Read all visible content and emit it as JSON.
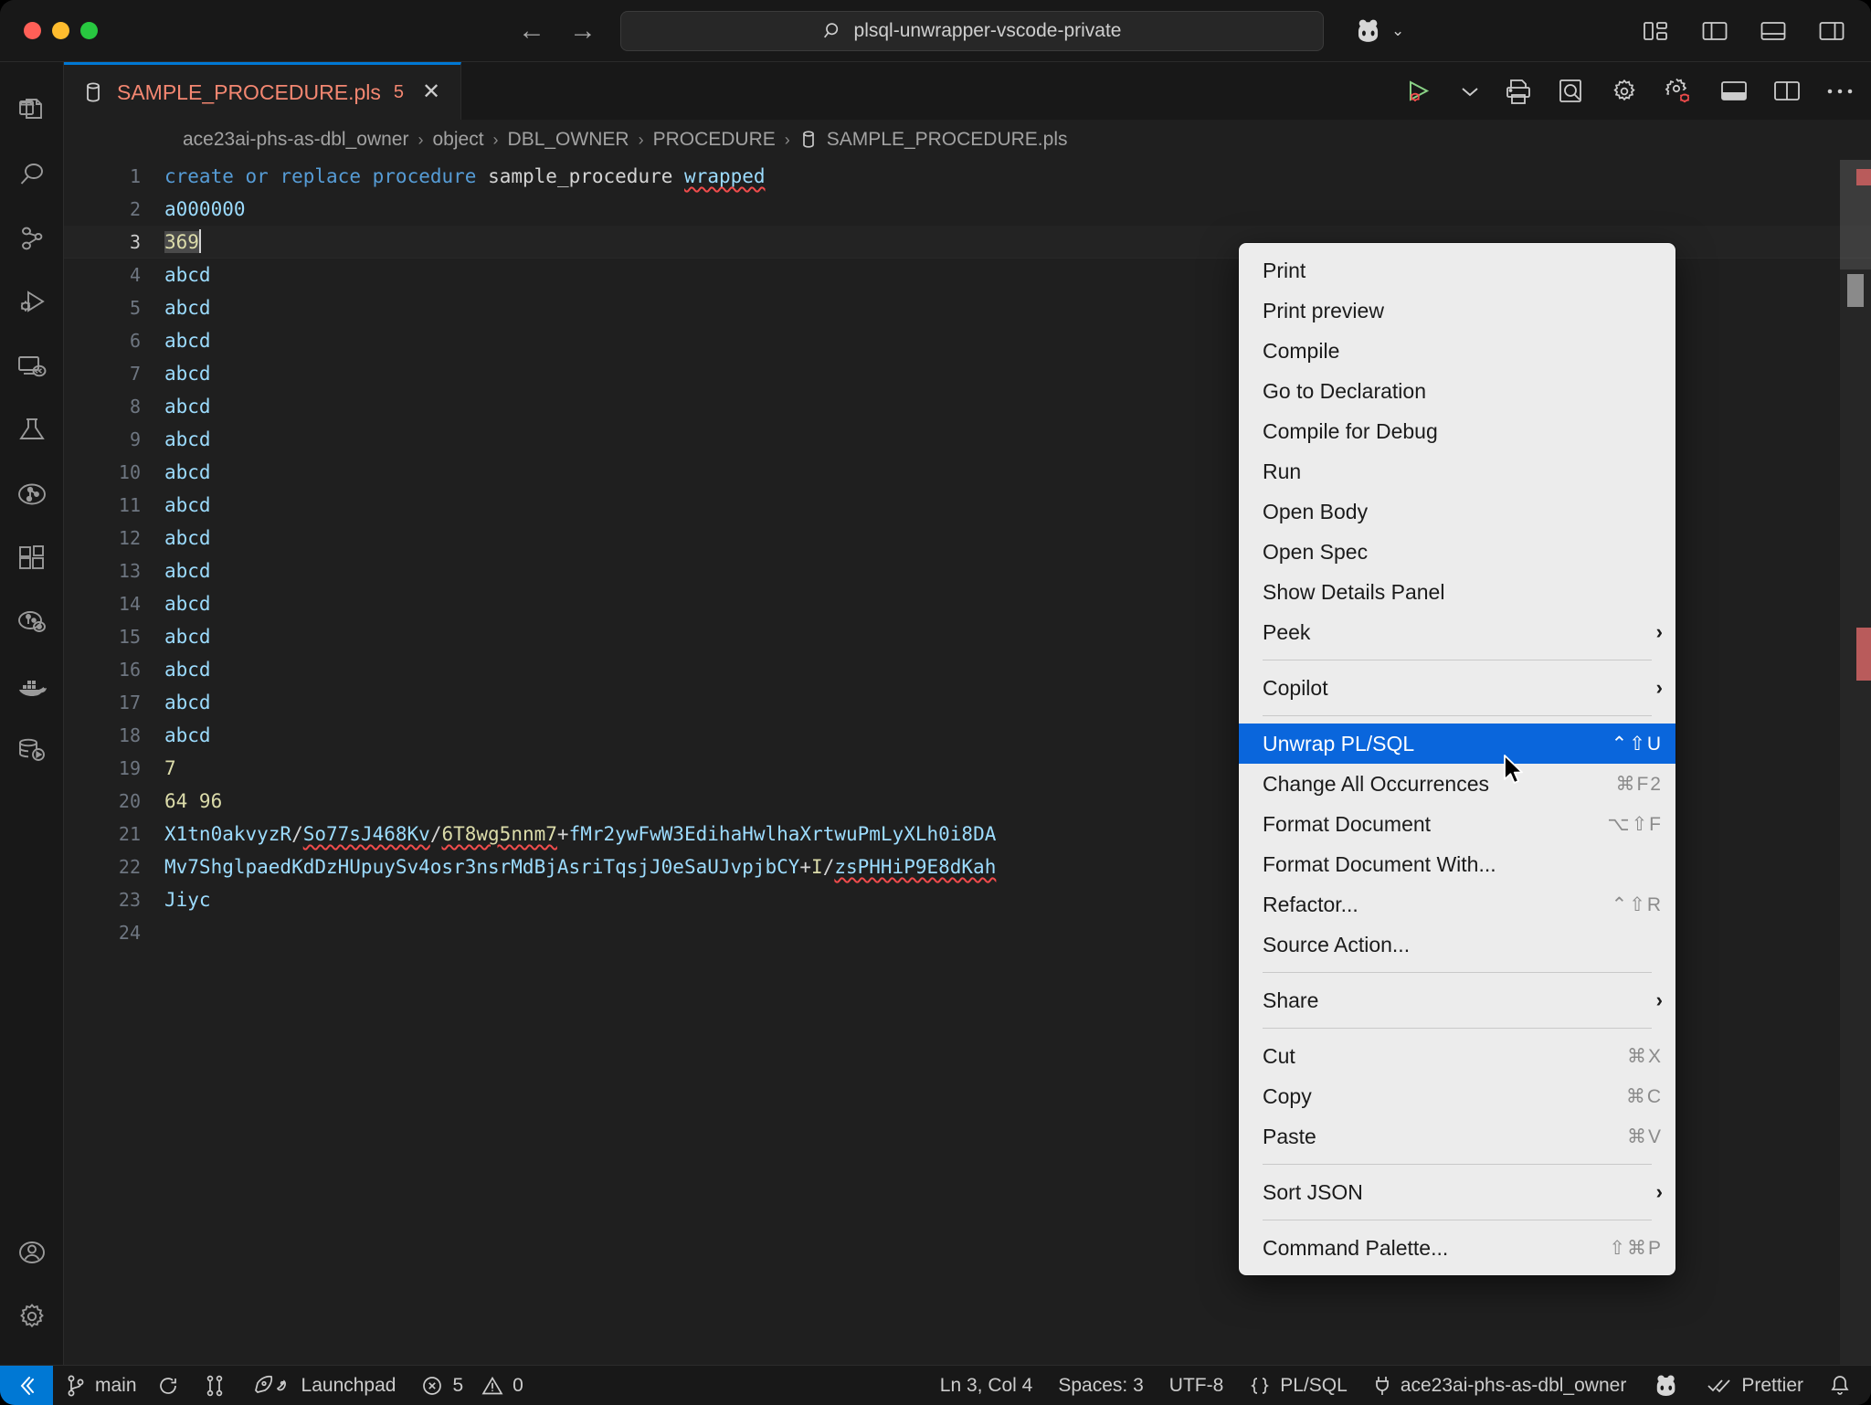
{
  "window": {
    "traffic_lights": [
      "close",
      "minimize",
      "maximize"
    ],
    "back_label": "←",
    "forward_label": "→",
    "command_center_text": "plsql-unwrapper-vscode-private",
    "copilot_icon": "copilot-icon",
    "layout_icons": [
      "customize-layout-icon",
      "toggle-primary-sidebar-icon",
      "toggle-panel-icon",
      "toggle-secondary-sidebar-icon"
    ]
  },
  "activity_bar": {
    "items": [
      {
        "name": "explorer",
        "icon": "files-icon"
      },
      {
        "name": "search",
        "icon": "search-icon"
      },
      {
        "name": "source-control",
        "icon": "source-control-icon"
      },
      {
        "name": "run-and-debug",
        "icon": "run-debug-icon"
      },
      {
        "name": "remote-explorer",
        "icon": "remote-explorer-icon"
      },
      {
        "name": "testing",
        "icon": "beaker-icon"
      },
      {
        "name": "database-graph",
        "icon": "database-graph-icon"
      },
      {
        "name": "extensions",
        "icon": "extensions-icon"
      },
      {
        "name": "sql-developer",
        "icon": "sql-developer-icon"
      },
      {
        "name": "docker",
        "icon": "docker-whale-icon"
      },
      {
        "name": "database-run",
        "icon": "database-run-icon"
      }
    ],
    "bottom_items": [
      {
        "name": "accounts",
        "icon": "account-icon"
      },
      {
        "name": "manage",
        "icon": "gear-icon"
      }
    ]
  },
  "tabs": [
    {
      "icon": "database-file-icon",
      "label": "SAMPLE_PROCEDURE.pls",
      "badge": "5",
      "close": "✕",
      "active": true
    }
  ],
  "editor_actions": [
    {
      "name": "run-or-debug",
      "icon": "run-debug-play-icon"
    },
    {
      "name": "run-dropdown",
      "icon": "chevron-down-icon"
    },
    {
      "name": "print",
      "icon": "printer-icon"
    },
    {
      "name": "print-preview",
      "icon": "print-preview-icon"
    },
    {
      "name": "compile",
      "icon": "gear-icon"
    },
    {
      "name": "compile-for-debug",
      "icon": "gear-bug-icon"
    },
    {
      "name": "toggle-panel",
      "icon": "panel-icon"
    },
    {
      "name": "split-editor",
      "icon": "split-editor-icon"
    },
    {
      "name": "more-actions",
      "icon": "ellipsis-icon"
    }
  ],
  "breadcrumb": {
    "separator": "›",
    "items": [
      {
        "label": "ace23ai-phs-as-dbl_owner",
        "icon": null
      },
      {
        "label": "object",
        "icon": null
      },
      {
        "label": "DBL_OWNER",
        "icon": null
      },
      {
        "label": "PROCEDURE",
        "icon": null
      },
      {
        "label": "SAMPLE_PROCEDURE.pls",
        "icon": "database-file-icon"
      }
    ]
  },
  "editor": {
    "language": "PL/SQL",
    "current_line": 3,
    "lines": [
      {
        "n": "1",
        "text": "create or replace procedure sample_procedure wrapped"
      },
      {
        "n": "2",
        "text": "a000000"
      },
      {
        "n": "3",
        "text": "369"
      },
      {
        "n": "4",
        "text": "abcd"
      },
      {
        "n": "5",
        "text": "abcd"
      },
      {
        "n": "6",
        "text": "abcd"
      },
      {
        "n": "7",
        "text": "abcd"
      },
      {
        "n": "8",
        "text": "abcd"
      },
      {
        "n": "9",
        "text": "abcd"
      },
      {
        "n": "10",
        "text": "abcd"
      },
      {
        "n": "11",
        "text": "abcd"
      },
      {
        "n": "12",
        "text": "abcd"
      },
      {
        "n": "13",
        "text": "abcd"
      },
      {
        "n": "14",
        "text": "abcd"
      },
      {
        "n": "15",
        "text": "abcd"
      },
      {
        "n": "16",
        "text": "abcd"
      },
      {
        "n": "17",
        "text": "abcd"
      },
      {
        "n": "18",
        "text": "abcd"
      },
      {
        "n": "19",
        "text": "7"
      },
      {
        "n": "20",
        "text": "64 96"
      },
      {
        "n": "21",
        "text": "X1tn0akvyzR/So77sJ468Kv/6T8wg5nnm7+fMr2ywFwW3EdihaHwlhaXrtwuPmLyXLh0i8DA"
      },
      {
        "n": "22",
        "text": "Mv7ShglpaedKdDzHUpuySv4osr3nsrMdBjAsriTqsjJ0eSaUJvpjbCY+I/zsPHHiP9E8dKah"
      },
      {
        "n": "23",
        "text": "Jiyc"
      },
      {
        "n": "24",
        "text": ""
      }
    ]
  },
  "context_menu": {
    "items": [
      {
        "label": "Print",
        "accel": "",
        "submenu": false,
        "selected": false
      },
      {
        "label": "Print preview",
        "accel": "",
        "submenu": false,
        "selected": false
      },
      {
        "label": "Compile",
        "accel": "",
        "submenu": false,
        "selected": false
      },
      {
        "label": "Go to Declaration",
        "accel": "",
        "submenu": false,
        "selected": false
      },
      {
        "label": "Compile for Debug",
        "accel": "",
        "submenu": false,
        "selected": false
      },
      {
        "label": "Run",
        "accel": "",
        "submenu": false,
        "selected": false
      },
      {
        "label": "Open Body",
        "accel": "",
        "submenu": false,
        "selected": false
      },
      {
        "label": "Open Spec",
        "accel": "",
        "submenu": false,
        "selected": false
      },
      {
        "label": "Show Details Panel",
        "accel": "",
        "submenu": false,
        "selected": false
      },
      {
        "label": "Peek",
        "accel": "",
        "submenu": true,
        "selected": false
      },
      {
        "separator": true
      },
      {
        "label": "Copilot",
        "accel": "",
        "submenu": true,
        "selected": false
      },
      {
        "separator": true
      },
      {
        "label": "Unwrap PL/SQL",
        "accel": "⌃⇧U",
        "submenu": false,
        "selected": true
      },
      {
        "label": "Change All Occurrences",
        "accel": "⌘F2",
        "submenu": false,
        "selected": false
      },
      {
        "label": "Format Document",
        "accel": "⌥⇧F",
        "submenu": false,
        "selected": false
      },
      {
        "label": "Format Document With...",
        "accel": "",
        "submenu": false,
        "selected": false
      },
      {
        "label": "Refactor...",
        "accel": "⌃⇧R",
        "submenu": false,
        "selected": false
      },
      {
        "label": "Source Action...",
        "accel": "",
        "submenu": false,
        "selected": false
      },
      {
        "separator": true
      },
      {
        "label": "Share",
        "accel": "",
        "submenu": true,
        "selected": false
      },
      {
        "separator": true
      },
      {
        "label": "Cut",
        "accel": "⌘X",
        "submenu": false,
        "selected": false
      },
      {
        "label": "Copy",
        "accel": "⌘C",
        "submenu": false,
        "selected": false
      },
      {
        "label": "Paste",
        "accel": "⌘V",
        "submenu": false,
        "selected": false
      },
      {
        "separator": true
      },
      {
        "label": "Sort JSON",
        "accel": "",
        "submenu": true,
        "selected": false
      },
      {
        "separator": true
      },
      {
        "label": "Command Palette...",
        "accel": "⇧⌘P",
        "submenu": false,
        "selected": false
      }
    ],
    "submenu_arrow": "›",
    "selected_bg": "#0a66dc"
  },
  "status_bar": {
    "remote_icon": "remote-host-icon",
    "left": [
      {
        "name": "branch",
        "icon": "git-branch-icon",
        "label": "main"
      },
      {
        "name": "sync",
        "icon": "sync-icon",
        "label": ""
      },
      {
        "name": "source-control-graph",
        "icon": "git-graph-icon",
        "label": ""
      },
      {
        "name": "launchpad",
        "icon": "rocket-icon",
        "label": "Launchpad"
      },
      {
        "name": "problems",
        "icon": "error-warning-icon",
        "label": "5   0",
        "errors": "5",
        "warnings": "0"
      }
    ],
    "right": [
      {
        "name": "cursor-position",
        "label": "Ln 3, Col 4"
      },
      {
        "name": "indentation",
        "label": "Spaces: 3"
      },
      {
        "name": "encoding",
        "label": "UTF-8"
      },
      {
        "name": "language-mode",
        "label": "PL/SQL",
        "icon": "braces-icon"
      },
      {
        "name": "db-connection",
        "label": "ace23ai-phs-as-dbl_owner",
        "icon": "plug-icon"
      },
      {
        "name": "copilot",
        "label": "",
        "icon": "copilot-icon"
      },
      {
        "name": "prettier",
        "label": "Prettier",
        "icon": "check-check-icon"
      },
      {
        "name": "notifications",
        "label": "",
        "icon": "bell-icon"
      }
    ]
  },
  "colors": {
    "accent": "#0078d4",
    "menu_selected": "#0a66dc",
    "tab_text": "#f48771",
    "error_marker": "#b95b5b",
    "editor_bg": "#1f1f1f",
    "chrome_bg": "#181818"
  }
}
